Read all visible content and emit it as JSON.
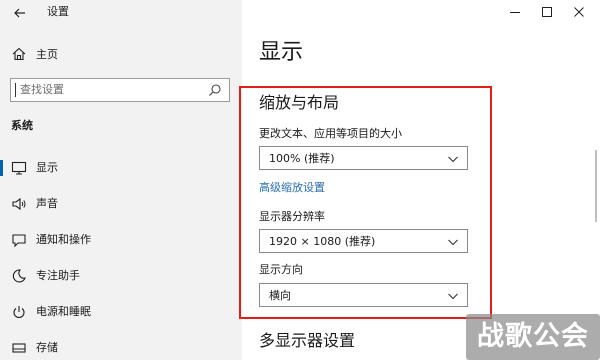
{
  "app": {
    "title": "设置",
    "back_icon": "back-arrow-icon"
  },
  "window_controls": {
    "minimize_icon": "minimize-icon",
    "maximize_icon": "maximize-icon",
    "close_icon": "close-icon"
  },
  "sidebar": {
    "home_label": "主页",
    "search_placeholder": "查找设置",
    "section_label": "系统",
    "items": [
      {
        "label": "显示",
        "icon": "monitor-icon",
        "selected": true
      },
      {
        "label": "声音",
        "icon": "speaker-icon",
        "selected": false
      },
      {
        "label": "通知和操作",
        "icon": "message-icon",
        "selected": false
      },
      {
        "label": "专注助手",
        "icon": "moon-icon",
        "selected": false
      },
      {
        "label": "电源和睡眠",
        "icon": "power-icon",
        "selected": false
      },
      {
        "label": "存储",
        "icon": "storage-icon",
        "selected": false
      }
    ]
  },
  "main": {
    "page_title": "显示",
    "scale_section_title": "缩放与布局",
    "scale_label": "更改文本、应用等项目的大小",
    "scale_value": "100% (推荐)",
    "advanced_link": "高级缩放设置",
    "resolution_label": "显示器分辨率",
    "resolution_value": "1920 × 1080 (推荐)",
    "orientation_label": "显示方向",
    "orientation_value": "横向",
    "multi_display_title": "多显示器设置"
  },
  "watermark": {
    "text": "战歌公会"
  },
  "colors": {
    "highlight_border": "#e41c1c",
    "link": "#2b6fb5",
    "accent": "#0063b1",
    "sidebar_bg": "#f2f2f2"
  }
}
